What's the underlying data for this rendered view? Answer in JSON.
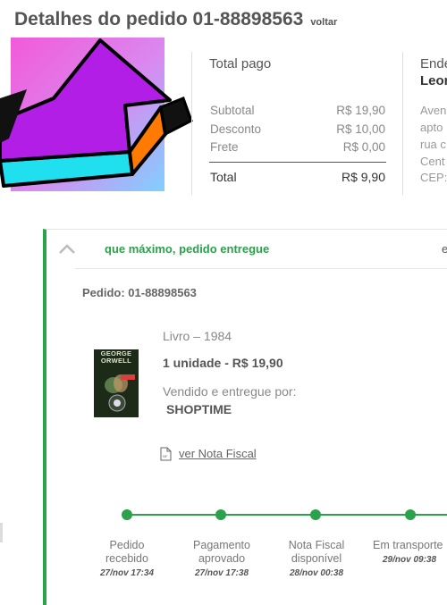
{
  "header": {
    "title": "Detalhes do pedido 01-88898563",
    "back_label": "voltar"
  },
  "payment": {
    "title": "Total pago",
    "rows": [
      {
        "label": "Subtotal",
        "value": "R$ 19,90"
      },
      {
        "label": "Desconto",
        "value": "R$ 10,00"
      },
      {
        "label": "Frete",
        "value": "R$ 0,00"
      }
    ],
    "total_label": "Total",
    "total_value": "R$ 9,90"
  },
  "address": {
    "title": "Ende",
    "name": "Leor",
    "lines": [
      "Aven",
      "apto",
      "rua c",
      "Cent",
      "CEP:"
    ]
  },
  "order": {
    "status": "que máximo, pedido entregue",
    "right_clip": "e",
    "number": "Pedido: 01-88898563",
    "product_name": "Livro – 1984",
    "product_qty": "1 unidade - R$ 19,90",
    "sold_by_label": "Vendido e entregue por:",
    "seller": "SHOPTIME",
    "invoice_link": "ver Nota Fiscal",
    "book_author": "GEORGE ORWELL"
  },
  "tracking": {
    "steps": [
      {
        "label": "Pedido\nrecebido",
        "time": "27/nov 17:34"
      },
      {
        "label": "Pagamento\naprovado",
        "time": "27/nov 17:38"
      },
      {
        "label": "Nota Fiscal\ndisponível",
        "time": "28/nov 00:38"
      },
      {
        "label": "Em transporte",
        "time": "29/nov 09:38"
      }
    ]
  },
  "colors": {
    "accent_green": "#2aa14a",
    "arrow_fill": "#b31ee6",
    "arrow_left": "#20e0f0",
    "arrow_right": "#ff7a00"
  },
  "icons": {
    "back_chevron": "chevron-up-icon",
    "invoice": "document-icon",
    "overlay": "arrow-icon"
  }
}
